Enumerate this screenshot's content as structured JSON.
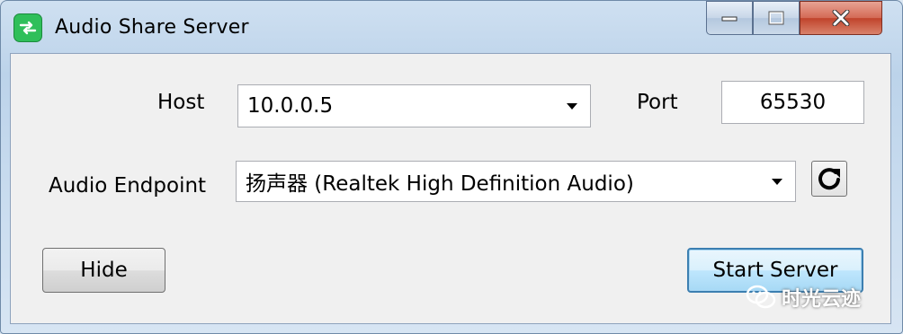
{
  "window": {
    "title": "Audio Share Server",
    "icon": "share-arrow-icon",
    "controls": {
      "minimize": "minimize-icon",
      "maximize": "maximize-icon",
      "close": "close-icon"
    }
  },
  "form": {
    "host_label": "Host",
    "host_value": "10.0.0.5",
    "port_label": "Port",
    "port_value": "65530",
    "endpoint_label": "Audio Endpoint",
    "endpoint_value": "扬声器 (Realtek High Definition Audio)",
    "refresh_icon": "refresh-icon"
  },
  "buttons": {
    "hide": "Hide",
    "start": "Start Server"
  },
  "watermark": {
    "text": "时光云迹",
    "icon": "wechat-icon"
  },
  "colors": {
    "app_icon": "#2fbf5a",
    "close_button": "#c0432b",
    "default_button_border": "#3c7fb1"
  }
}
